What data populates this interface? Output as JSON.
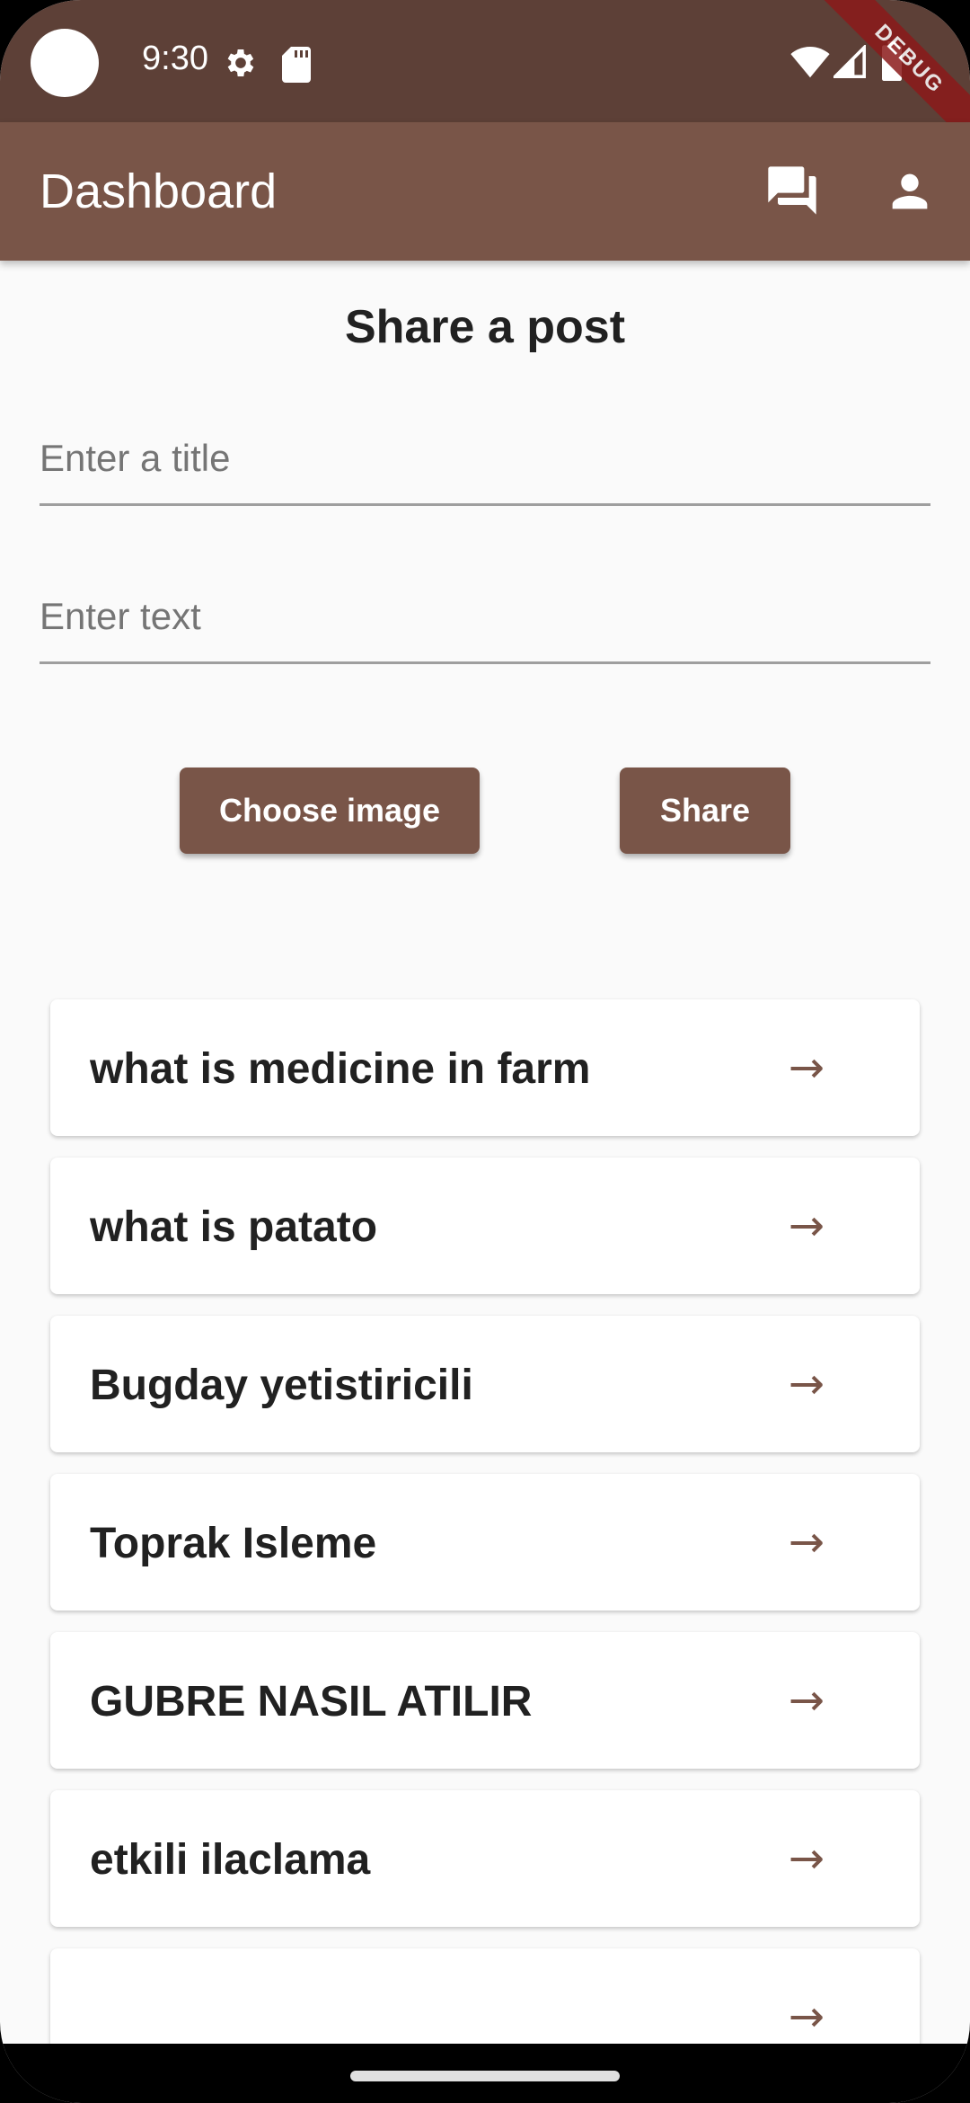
{
  "status_bar": {
    "time": "9:30",
    "debug_label": "DEBUG"
  },
  "app_bar": {
    "title": "Dashboard"
  },
  "composer": {
    "heading": "Share a post",
    "title_placeholder": "Enter a title",
    "text_placeholder": "Enter text",
    "choose_image_label": "Choose image",
    "share_label": "Share"
  },
  "posts": [
    {
      "title": "what is medicine in farm",
      "arrow": "→"
    },
    {
      "title": "what is patato",
      "arrow": "→"
    },
    {
      "title": "Bugday yetistiricili",
      "arrow": "→"
    },
    {
      "title": "Toprak Isleme",
      "arrow": "→"
    },
    {
      "title": "GUBRE NASIL ATILIR",
      "arrow": "→"
    },
    {
      "title": "etkili ilaclama",
      "arrow": "→"
    },
    {
      "title": "",
      "arrow": "→"
    }
  ],
  "colors": {
    "status_bar": "#5d4037",
    "app_bar": "#795548",
    "accent": "#795548",
    "background": "#fafafa"
  },
  "icons": {
    "status": [
      "camera-cutout",
      "gear-icon",
      "sd-card-icon",
      "wifi-icon",
      "signal-icon",
      "battery-icon"
    ],
    "app_bar": [
      "chat-icon",
      "person-icon"
    ]
  }
}
